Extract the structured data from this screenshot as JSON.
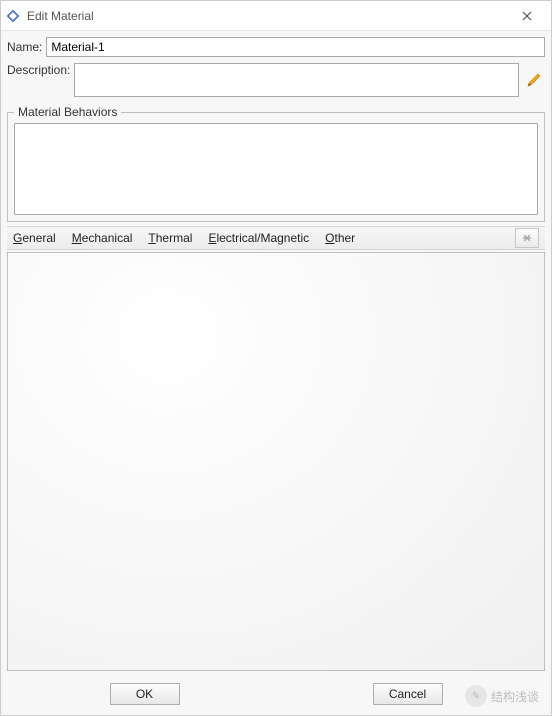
{
  "window": {
    "title": "Edit Material"
  },
  "fields": {
    "name_label": "Name:",
    "name_value": "Material-1",
    "description_label": "Description:",
    "description_value": ""
  },
  "behaviors": {
    "legend": "Material Behaviors"
  },
  "menu": {
    "general": "General",
    "mechanical": "Mechanical",
    "thermal": "Thermal",
    "electrical": "Electrical/Magnetic",
    "other": "Other"
  },
  "buttons": {
    "ok": "OK",
    "cancel": "Cancel"
  },
  "watermark": {
    "text": "结构浅谈"
  }
}
